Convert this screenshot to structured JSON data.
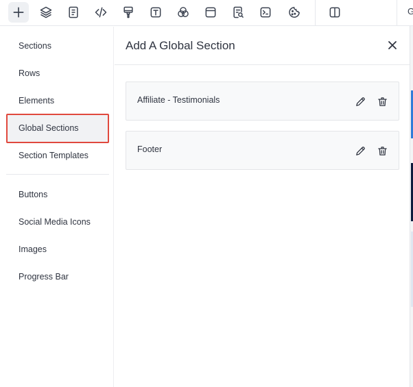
{
  "toolbar": {
    "buttons": [
      {
        "name": "add-icon",
        "tooltip": "Add"
      },
      {
        "name": "layers-icon",
        "tooltip": "Layers"
      },
      {
        "name": "page-icon",
        "tooltip": "Pages"
      },
      {
        "name": "code-icon",
        "tooltip": "Code"
      },
      {
        "name": "paint-brush-icon",
        "tooltip": "Styles"
      },
      {
        "name": "text-icon",
        "tooltip": "Typography"
      },
      {
        "name": "color-circles-icon",
        "tooltip": "Colors"
      },
      {
        "name": "layout-icon",
        "tooltip": "Layout"
      },
      {
        "name": "search-document-icon",
        "tooltip": "SEO"
      },
      {
        "name": "terminal-icon",
        "tooltip": "Scripts"
      },
      {
        "name": "cookie-icon",
        "tooltip": "Cookies"
      },
      {
        "name": "split-view-icon",
        "tooltip": "Split view"
      }
    ],
    "truncated_label": "G"
  },
  "sidebar": {
    "items": [
      {
        "label": "Sections"
      },
      {
        "label": "Rows"
      },
      {
        "label": "Elements"
      },
      {
        "label": "Global Sections",
        "selected": true
      },
      {
        "label": "Section Templates"
      },
      {
        "label": "Buttons"
      },
      {
        "label": "Social Media Icons"
      },
      {
        "label": "Images"
      },
      {
        "label": "Progress Bar"
      }
    ]
  },
  "panel": {
    "title": "Add A Global Section",
    "sections": [
      {
        "label": "Affiliate - Testimonials"
      },
      {
        "label": "Footer"
      }
    ]
  },
  "colors": {
    "selection_border": "#e0483d",
    "text": "#2f3440",
    "card_bg": "#f8f9fa",
    "canvas_blue": "#2f7bd8",
    "canvas_navy": "#0d1b3d"
  }
}
